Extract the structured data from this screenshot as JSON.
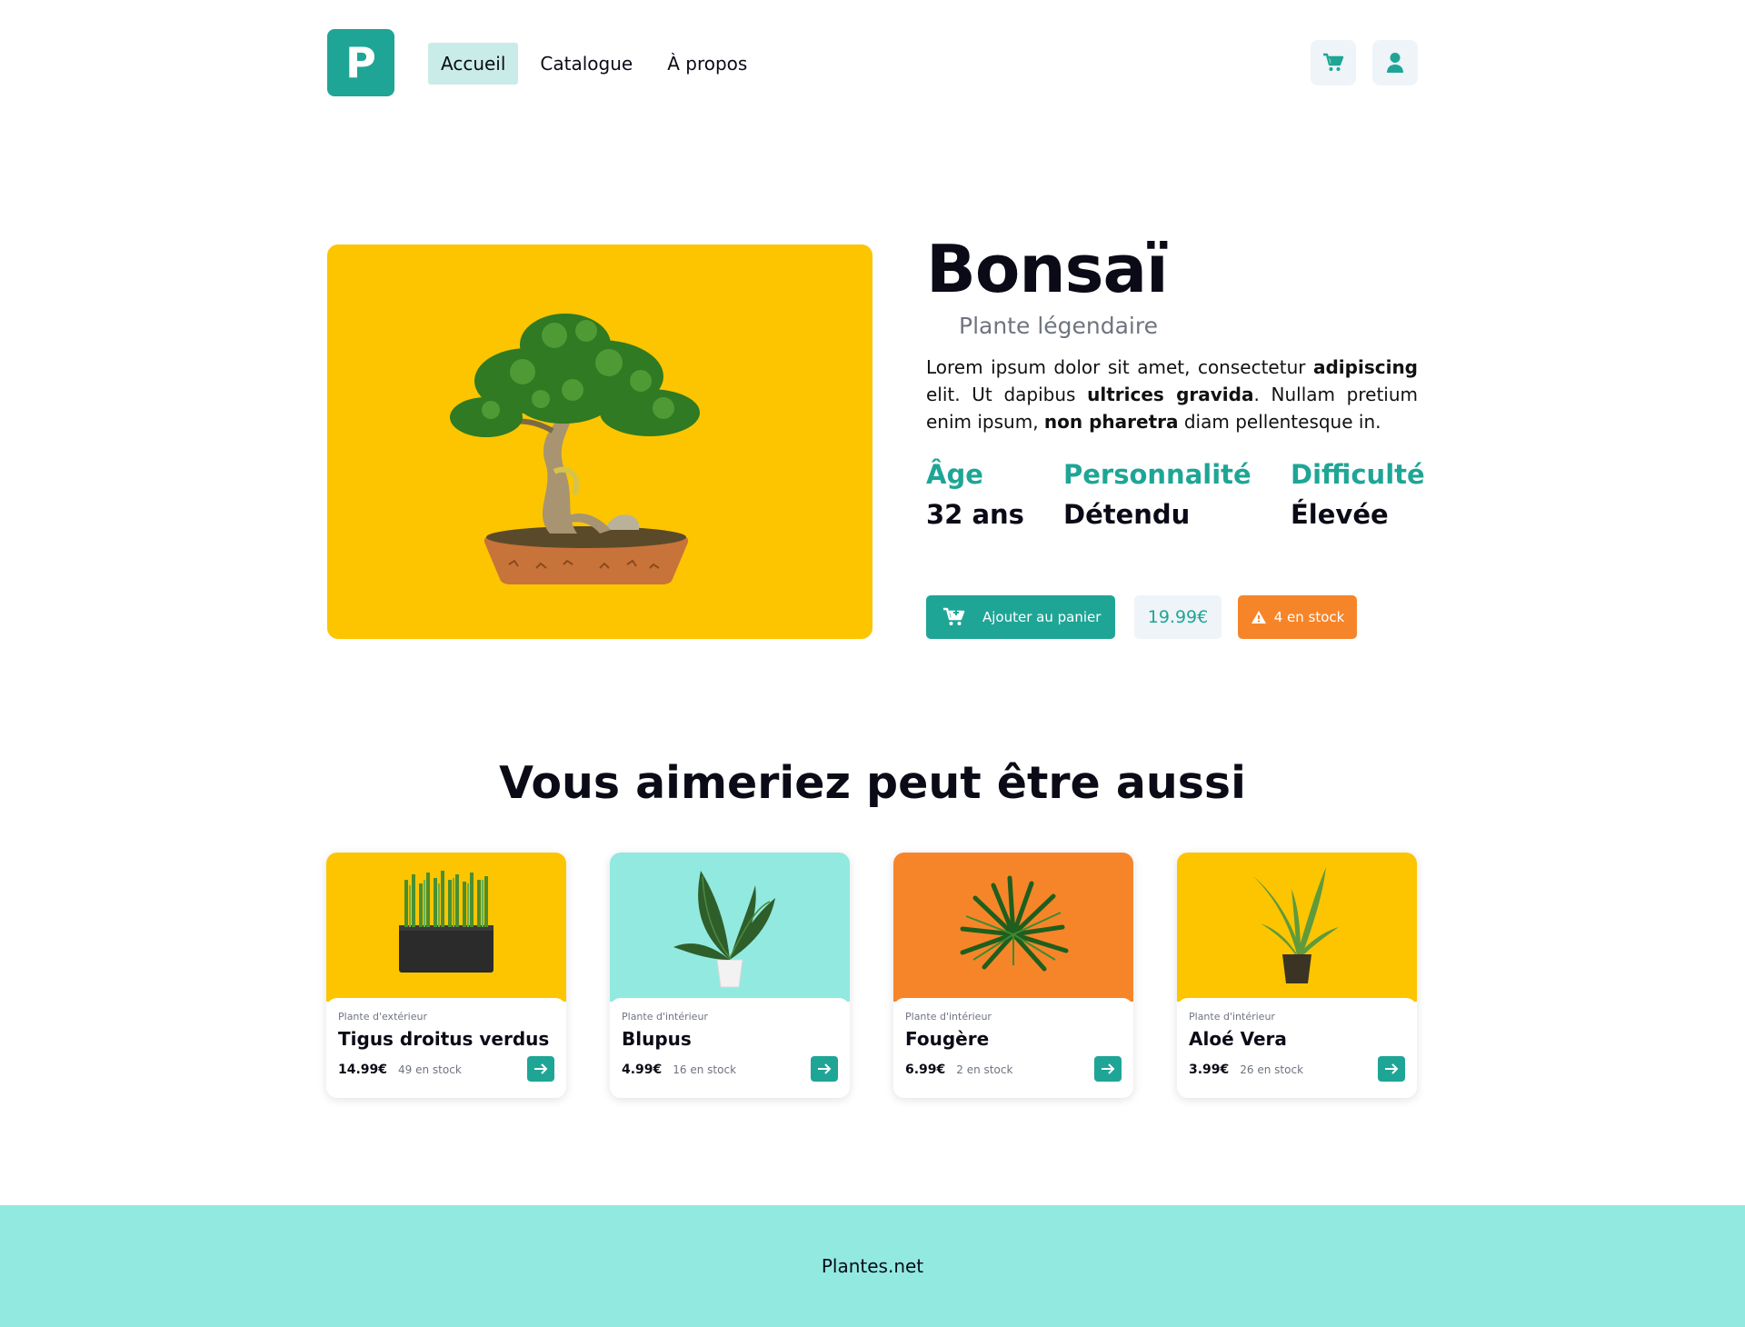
{
  "header": {
    "logo_letter": "P",
    "nav": [
      {
        "label": "Accueil",
        "active": true
      },
      {
        "label": "Catalogue",
        "active": false
      },
      {
        "label": "À propos",
        "active": false
      }
    ],
    "icons": {
      "cart": "cart-icon",
      "user": "user-icon"
    }
  },
  "product": {
    "name": "Bonsaï",
    "subtitle": "Plante légendaire",
    "description_parts": [
      {
        "text": "Lorem ipsum dolor sit amet, consectetur ",
        "bold": false
      },
      {
        "text": "adipiscing",
        "bold": true
      },
      {
        "text": " elit. Ut dapibus ",
        "bold": false
      },
      {
        "text": "ultrices gravida",
        "bold": true
      },
      {
        "text": ". Nullam pretium enim ipsum, ",
        "bold": false
      },
      {
        "text": "non pharetra",
        "bold": true
      },
      {
        "text": " diam pellentesque in.",
        "bold": false
      }
    ],
    "stats": [
      {
        "label": "Âge",
        "value": "32 ans"
      },
      {
        "label": "Personnalité",
        "value": "Détendu"
      },
      {
        "label": "Difficulté",
        "value": "Élevée"
      }
    ],
    "add_to_cart_label": "Ajouter au panier",
    "price": "19.99€",
    "stock": "4 en stock",
    "image_bg": "#fcc500"
  },
  "section": {
    "title": "Vous aimeriez peut être aussi"
  },
  "cards": [
    {
      "category": "Plante d'extérieur",
      "name": "Tigus droitus verdus",
      "price": "14.99€",
      "stock": "49 en stock",
      "bg": "#fcc500",
      "plant": "grass-planter"
    },
    {
      "category": "Plante d'intérieur",
      "name": "Blupus",
      "price": "4.99€",
      "stock": "16 en stock",
      "bg": "#92e9e0",
      "plant": "leafy-pot"
    },
    {
      "category": "Plante d'intérieur",
      "name": "Fougère",
      "price": "6.99€",
      "stock": "2 en stock",
      "bg": "#f6852a",
      "plant": "fern"
    },
    {
      "category": "Plante d'intérieur",
      "name": "Aloé Vera",
      "price": "3.99€",
      "stock": "26 en stock",
      "bg": "#fcc500",
      "plant": "aloe"
    }
  ],
  "footer": {
    "text": "Plantes.net"
  },
  "colors": {
    "brand": "#1fa596",
    "accent_orange": "#f6852a",
    "yellow": "#fcc500",
    "mint": "#92e9e0"
  }
}
